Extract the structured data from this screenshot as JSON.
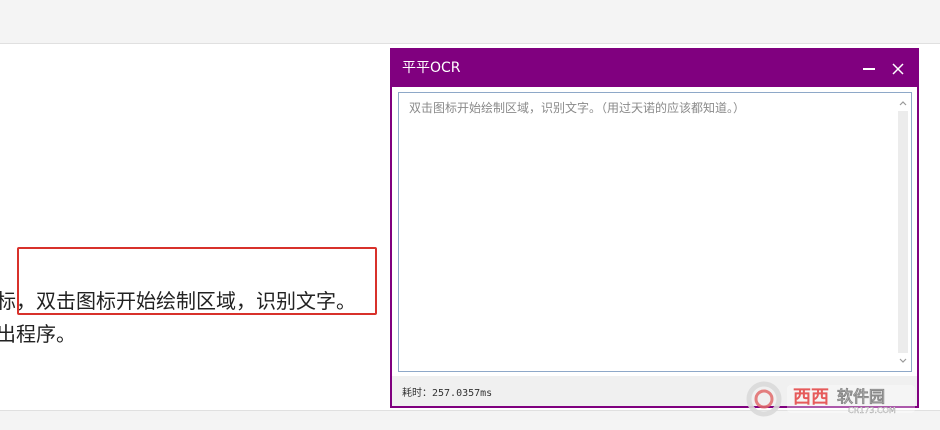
{
  "background": {
    "line_1": "标，双击图标开始绘制区域，识别文字。",
    "line_2": "出程序。"
  },
  "window": {
    "title": "平平OCR",
    "text_content": "双击图标开始绘制区域，识别文字。（用过天诺的应该都知道。）",
    "status": "耗时：257.0357ms"
  },
  "watermark": {
    "lettering": "西西软件园",
    "url": "CR173.COM"
  },
  "colors": {
    "window_accent": "#80007f",
    "highlight_box": "#d8312b"
  },
  "icons": {
    "minimize": "minimize-icon",
    "close": "close-icon",
    "scroll_up": "chevron-up-icon",
    "scroll_down": "chevron-down-icon"
  }
}
